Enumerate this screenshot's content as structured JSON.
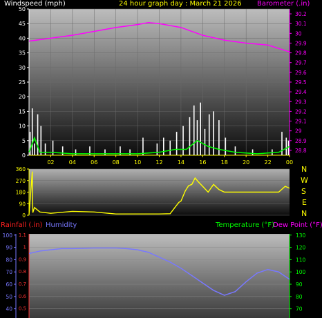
{
  "header": {
    "wind_label": "Windspeed (mph)",
    "title": "24 hour graph day : March 21 2026",
    "baro_label": "Barometer (.in)"
  },
  "lower_header": {
    "rain_label": "Rainfall (.in)",
    "humidity_label": "Humidity",
    "temp_label": "Temperature (°F)",
    "dew_label": "Dew Point (°F)"
  },
  "compass": [
    "N",
    "W",
    "S",
    "E",
    "N"
  ],
  "colors": {
    "wind": "#ffffff",
    "gust": "#00ff00",
    "barometer": "#ff00ff",
    "direction": "#ffff00",
    "humidity": "#7878ff",
    "temperature": "#00ff00",
    "dewpoint": "#ff00ff",
    "rain": "#ff0000"
  },
  "chart_data": [
    {
      "type": "line",
      "name": "wind-barometer",
      "x_ticks": [
        "02",
        "04",
        "06",
        "08",
        "10",
        "12",
        "14",
        "16",
        "18",
        "20",
        "22",
        "00"
      ],
      "y_left_ticks": [
        "0",
        "5",
        "10",
        "15",
        "20",
        "25",
        "30",
        "35",
        "40",
        "45",
        "50"
      ],
      "y_right_ticks": [
        "28.8",
        "28.9",
        "29",
        "29.1",
        "29.2",
        "29.3",
        "29.4",
        "29.5",
        "29.6",
        "29.7",
        "29.8",
        "29.9",
        "30",
        "30.1",
        "30.2"
      ],
      "ylim_left": [
        0,
        50
      ],
      "ylim_right": [
        28.75,
        30.25
      ],
      "barometer": {
        "x": [
          0,
          2,
          4,
          6,
          8,
          10,
          11,
          12,
          14,
          16,
          18,
          20,
          22,
          24
        ],
        "y": [
          29.92,
          29.95,
          29.98,
          30.02,
          30.06,
          30.09,
          30.11,
          30.1,
          30.06,
          29.98,
          29.93,
          29.9,
          29.88,
          29.81
        ]
      },
      "wind": {
        "x": [
          0.1,
          0.3,
          0.5,
          0.8,
          1.1,
          1.5,
          2.2,
          3.1,
          4.3,
          5.6,
          7.0,
          8.4,
          9.3,
          10.5,
          11.8,
          12.4,
          13.0,
          13.6,
          14.2,
          14.8,
          15.2,
          15.5,
          15.8,
          16.2,
          16.6,
          17.0,
          17.5,
          18.1,
          19.0,
          20.6,
          22.4,
          23.3,
          23.7,
          23.9
        ],
        "y": [
          8,
          16,
          4,
          14,
          10,
          4,
          5,
          3,
          2,
          3,
          2,
          3,
          2,
          6,
          4,
          6,
          5,
          8,
          10,
          13,
          17,
          12,
          18,
          9,
          14,
          15,
          12,
          6,
          3,
          2,
          2,
          8,
          6,
          5
        ]
      },
      "gust": {
        "x": [
          0,
          0.5,
          1,
          2,
          4,
          6,
          8,
          10,
          12,
          13.5,
          14.5,
          15.5,
          16.5,
          17.5,
          19,
          21,
          23,
          24
        ],
        "y": [
          1,
          6,
          1,
          1,
          0.5,
          0.5,
          0.5,
          0.5,
          1,
          2,
          2,
          5,
          3,
          2,
          1,
          0.5,
          1,
          3
        ]
      }
    },
    {
      "type": "line",
      "name": "wind-direction",
      "y_ticks": [
        "0",
        "90",
        "180",
        "270",
        "360"
      ],
      "ylim": [
        0,
        360
      ],
      "x": [
        0,
        0.3,
        0.35,
        0.5,
        1,
        2,
        4,
        6,
        8,
        10,
        12,
        13,
        13.8,
        14,
        14.4,
        14.7,
        15,
        15.3,
        15.6,
        16,
        16.5,
        17,
        17.5,
        18,
        20,
        22,
        23,
        23.6,
        24
      ],
      "y": [
        5,
        340,
        20,
        60,
        25,
        15,
        30,
        25,
        10,
        10,
        10,
        12,
        100,
        110,
        190,
        230,
        240,
        290,
        260,
        225,
        180,
        240,
        200,
        180,
        180,
        180,
        180,
        225,
        210
      ]
    },
    {
      "type": "line",
      "name": "humidity-temperature",
      "y_humidity_ticks": [
        "40",
        "50",
        "60",
        "70",
        "80",
        "90",
        "100"
      ],
      "y_rain_ticks": [
        "0.5",
        "0.6",
        "0.7",
        "0.8",
        "0.9",
        "1",
        "1.1"
      ],
      "y_temp_ticks": [
        "70",
        "80",
        "90",
        "100",
        "110",
        "120",
        "130"
      ],
      "ylim_humidity": [
        32.5,
        101
      ],
      "humidity": {
        "x": [
          0,
          1,
          2,
          3,
          4,
          6,
          8,
          9,
          10,
          11,
          12,
          13,
          14,
          15,
          16,
          17,
          18,
          19,
          20,
          21,
          22,
          23,
          24
        ],
        "y": [
          85,
          87,
          88,
          89,
          89,
          89.5,
          89.5,
          89,
          88,
          86,
          82,
          78,
          73,
          67,
          61,
          55,
          51,
          54,
          62,
          69,
          72,
          70,
          64
        ]
      }
    }
  ]
}
